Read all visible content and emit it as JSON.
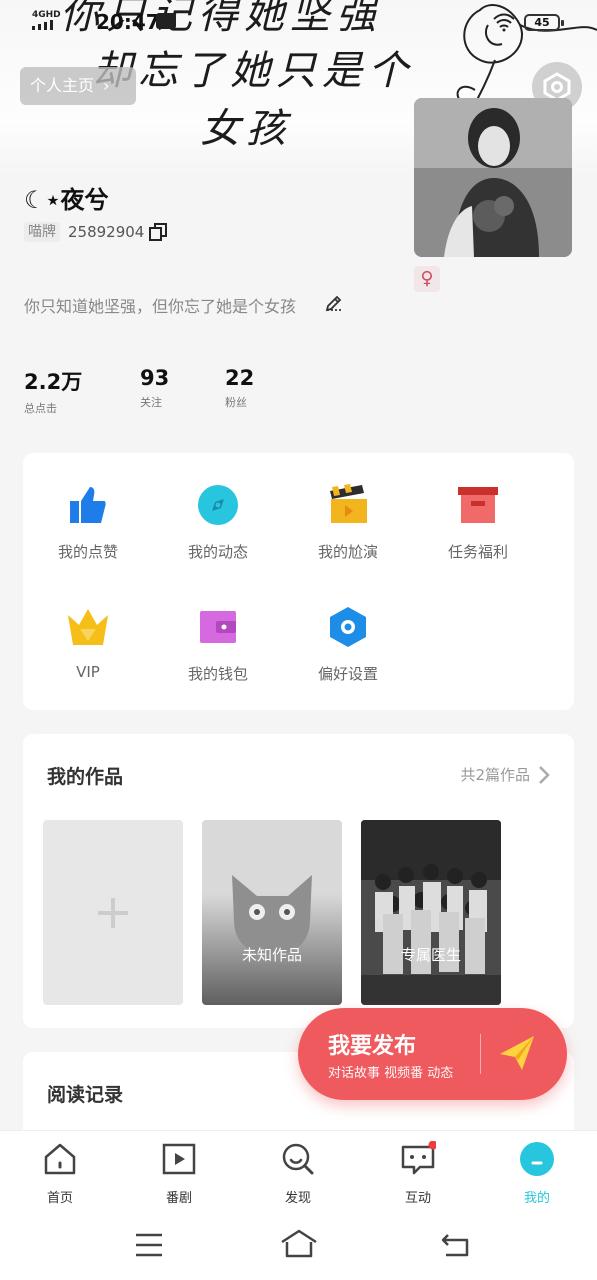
{
  "status_bar": {
    "network": "4GHD",
    "time": "20:47",
    "battery": "45"
  },
  "banner": {
    "line1": "你只记得她坚强",
    "line2": "却忘了她只是个",
    "line3": "女孩"
  },
  "header": {
    "home_chip_label": "个人主页"
  },
  "profile": {
    "username": "☾⋆夜兮",
    "id_label": "喵牌",
    "id_number": "25892904",
    "gender_symbol": "♀",
    "bio": "你只知道她坚强，但你忘了她是个女孩"
  },
  "stats": [
    {
      "value": "2.2万",
      "label": "总点击"
    },
    {
      "value": "93",
      "label": "关注"
    },
    {
      "value": "22",
      "label": "粉丝"
    }
  ],
  "features": [
    {
      "label": "我的点赞",
      "icon": "thumbs-up-icon",
      "color": "#1e7de8"
    },
    {
      "label": "我的动态",
      "icon": "compass-icon",
      "color": "#27c6de"
    },
    {
      "label": "我的尬演",
      "icon": "clapperboard-icon",
      "color": "#f3b51d"
    },
    {
      "label": "任务福利",
      "icon": "gift-box-icon",
      "color": "#ee4b4b"
    },
    {
      "label": "VIP",
      "icon": "crown-icon",
      "color": "#f5bf17"
    },
    {
      "label": "我的钱包",
      "icon": "wallet-icon",
      "color": "#d56ae0"
    },
    {
      "label": "偏好设置",
      "icon": "settings-hexagon-icon",
      "color": "#1e8de8"
    }
  ],
  "works": {
    "title": "我的作品",
    "count_label": "共2篇作品",
    "items": [
      {
        "caption": "未知作品"
      },
      {
        "caption": "专属医生"
      }
    ]
  },
  "history": {
    "title": "阅读记录"
  },
  "publish": {
    "title": "我要发布",
    "subtitle": "对话故事 视频番 动态"
  },
  "tabs": [
    {
      "label": "首页",
      "icon": "home-icon"
    },
    {
      "label": "番剧",
      "icon": "play-icon"
    },
    {
      "label": "发现",
      "icon": "discover-icon"
    },
    {
      "label": "互动",
      "icon": "message-icon"
    },
    {
      "label": "我的",
      "icon": "profile-icon",
      "active": true
    }
  ],
  "colors": {
    "accent": "#27c6de",
    "publish": "#ef5a5e"
  }
}
